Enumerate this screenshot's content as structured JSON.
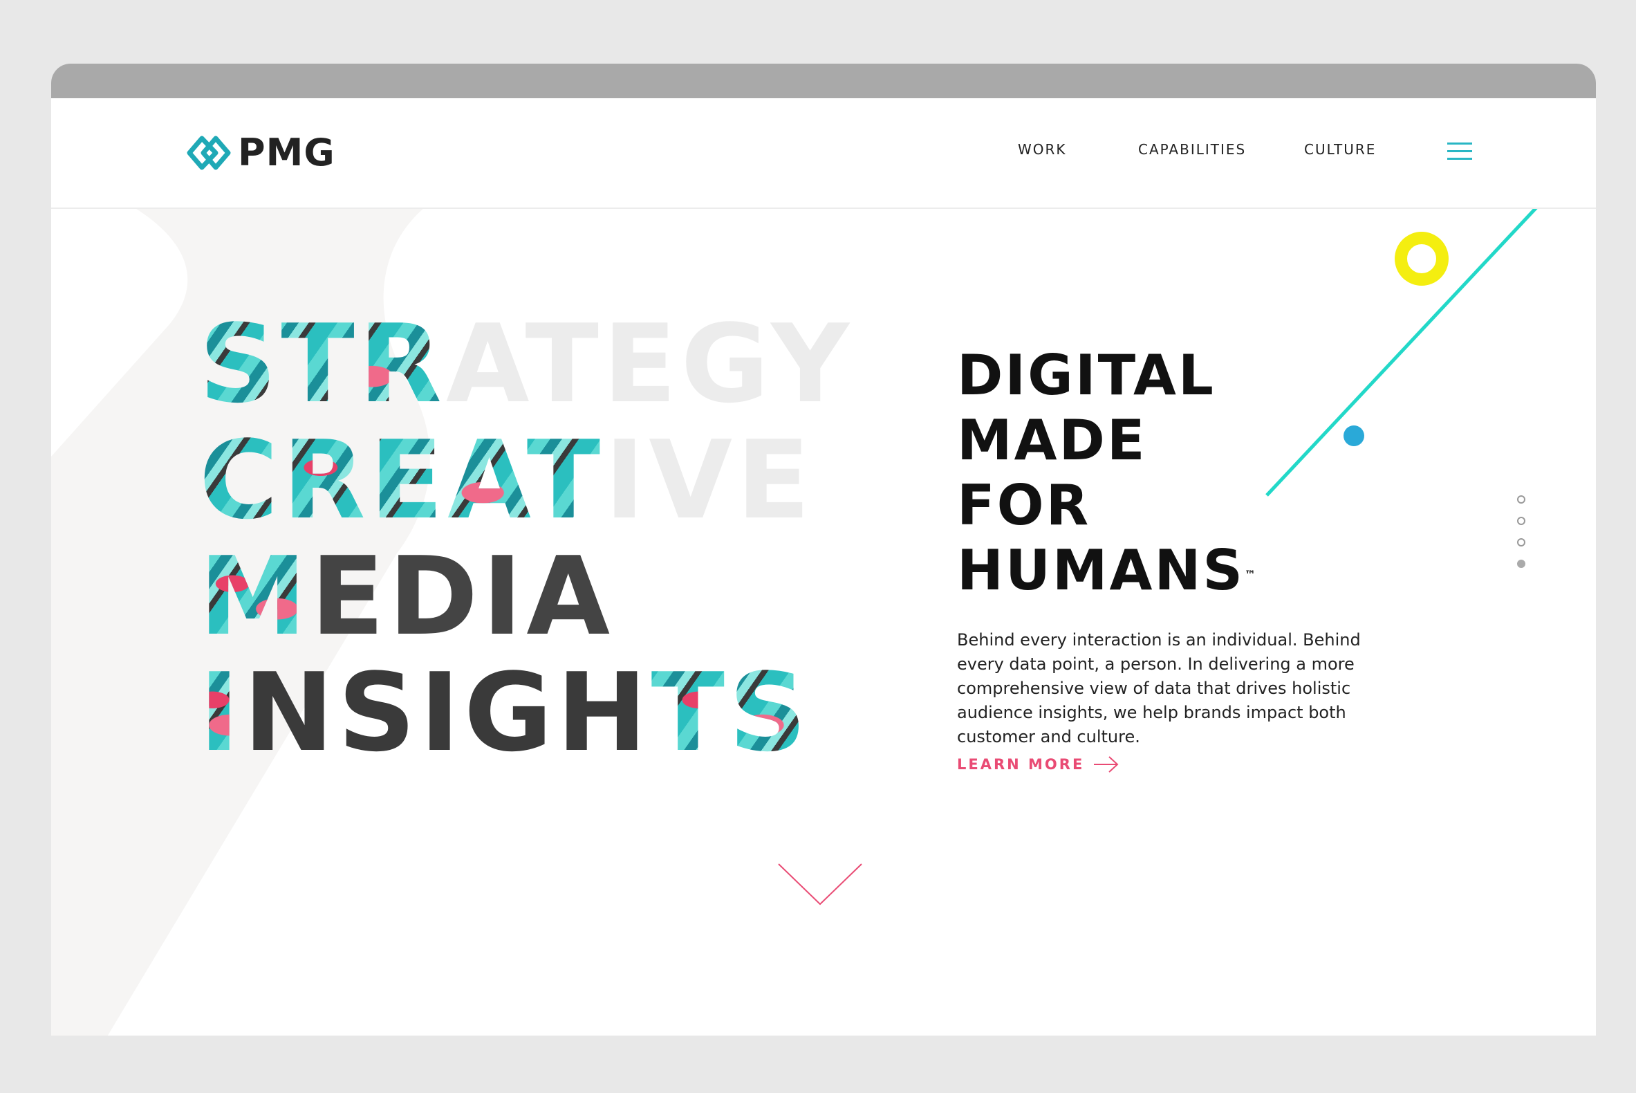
{
  "brand": {
    "name": "PMG"
  },
  "nav": {
    "items": [
      {
        "label": "WORK"
      },
      {
        "label": "CAPABILITIES"
      },
      {
        "label": "CULTURE"
      }
    ]
  },
  "hero": {
    "words": [
      "STRATEGY",
      "CREATIVE",
      "MEDIA",
      "INSIGHTS"
    ],
    "headline": [
      "DIGITAL",
      "MADE",
      "FOR",
      "HUMANS"
    ],
    "trademark": "™",
    "body": "Behind every interaction is an individual. Behind every data point, a person. In delivering a more comprehensive view of data that drives holistic audience insights, we help brands impact both customer and culture.",
    "cta": "LEARN MORE"
  },
  "pagination": {
    "count": 4,
    "active_index": 3
  },
  "colors": {
    "teal": "#29b6c4",
    "pink": "#e94b74",
    "yellow": "#f4ee10",
    "line_cyan": "#22d8c8",
    "dot_blue": "#2aa9d8"
  },
  "icons": {
    "logo": "pmg-diamond-logo-icon",
    "menu": "hamburger-menu-icon",
    "cta_arrow": "arrow-right-icon",
    "scroll": "chevron-down-icon"
  }
}
